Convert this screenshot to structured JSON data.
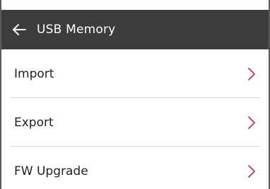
{
  "header": {
    "title": "USB Memory",
    "back_icon": "arrow-left-icon",
    "background": "#3c3c3c"
  },
  "menu": {
    "items": [
      {
        "label": "Import",
        "icon": "chevron-right-icon"
      },
      {
        "label": "Export",
        "icon": "chevron-right-icon"
      },
      {
        "label": "FW Upgrade",
        "icon": "chevron-right-icon"
      }
    ],
    "chevron_color": "#b03a5b"
  }
}
